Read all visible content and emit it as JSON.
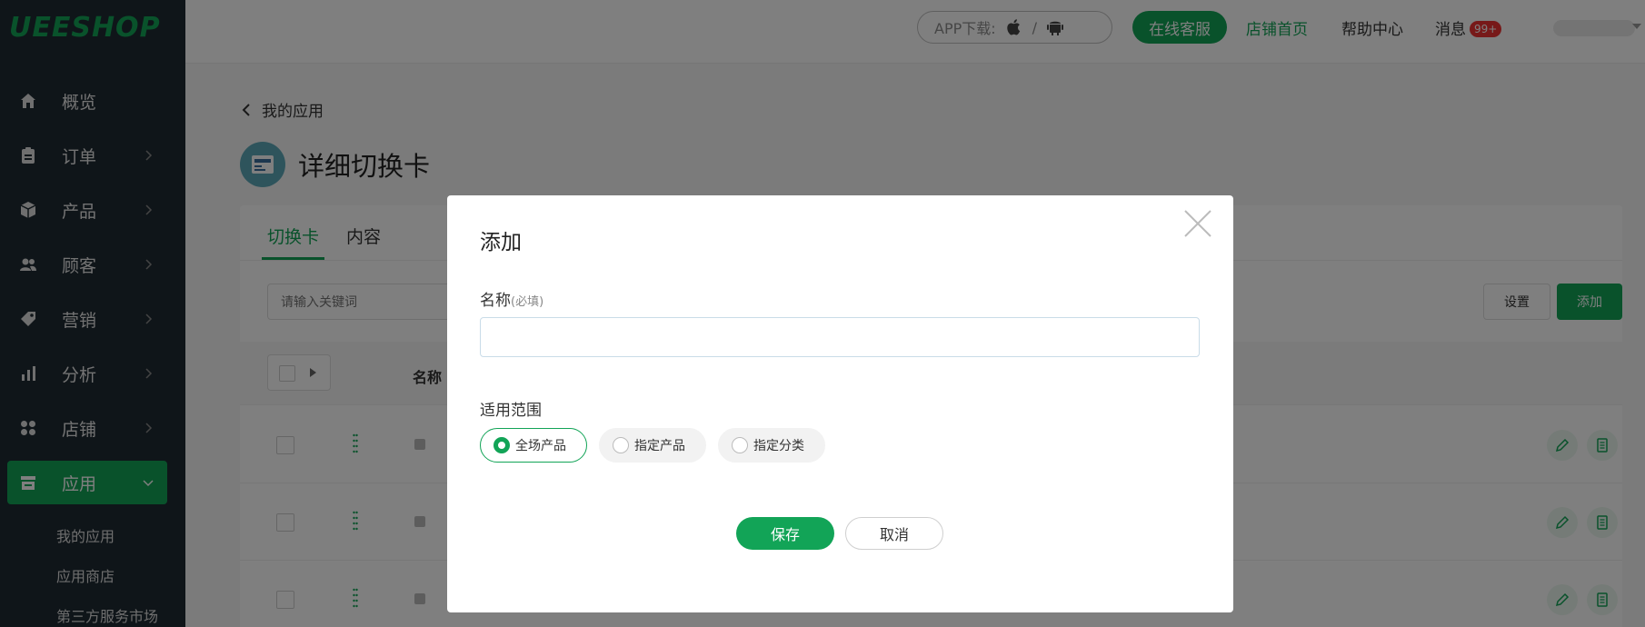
{
  "brand": {
    "logo": "UEESHOP",
    "accent": "#12a457"
  },
  "sidebar": {
    "items": [
      {
        "label": "概览",
        "icon": "home-icon"
      },
      {
        "label": "订单",
        "icon": "clipboard-icon"
      },
      {
        "label": "产品",
        "icon": "box-icon"
      },
      {
        "label": "顾客",
        "icon": "users-icon"
      },
      {
        "label": "营销",
        "icon": "tag-icon"
      },
      {
        "label": "分析",
        "icon": "bar-chart-icon"
      },
      {
        "label": "店铺",
        "icon": "grid-icon"
      },
      {
        "label": "应用",
        "icon": "store-icon",
        "active": true
      }
    ],
    "subitems": [
      "我的应用",
      "应用商店",
      "第三方服务市场"
    ]
  },
  "header": {
    "app_download": "APP下载:",
    "app_sep": "/",
    "online_service": "在线客服",
    "store_home": "店铺首页",
    "help_center": "帮助中心",
    "messages": "消息",
    "message_count": "99+"
  },
  "page": {
    "back_label": "我的应用",
    "title": "详细切换卡",
    "tabs": [
      "切换卡",
      "内容"
    ],
    "search_placeholder": "请输入关键词",
    "settings_button": "设置",
    "add_button": "添加",
    "columns": {
      "name": "名称"
    }
  },
  "modal": {
    "title": "添加",
    "name_label": "名称",
    "name_required": "(必填)",
    "name_value": "",
    "scope_label": "适用范围",
    "scope_options": [
      "全场产品",
      "指定产品",
      "指定分类"
    ],
    "scope_selected": "全场产品",
    "save": "保存",
    "cancel": "取消"
  }
}
